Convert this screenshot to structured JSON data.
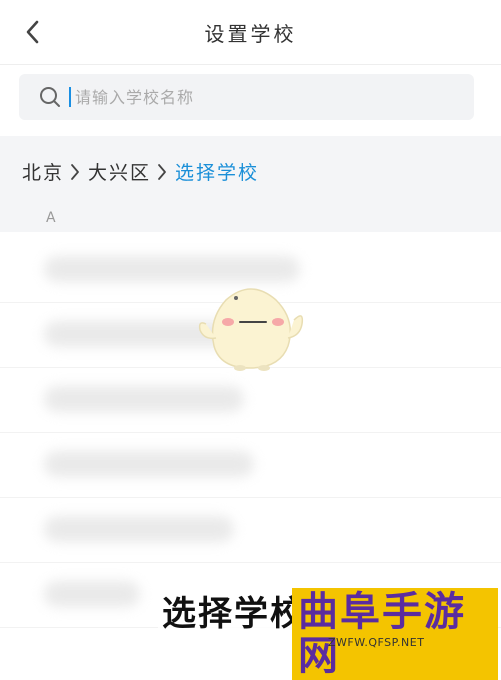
{
  "header": {
    "title": "设置学校"
  },
  "search": {
    "placeholder": "请输入学校名称"
  },
  "breadcrumb": [
    {
      "label": "北京"
    },
    {
      "label": "大兴区"
    },
    {
      "label": "选择学校"
    }
  ],
  "index_letter": "A",
  "caption": "选择学校",
  "watermark": {
    "text": "曲阜手游网",
    "url": "ZWFW.QFSP.NET"
  },
  "colors": {
    "accent": "#1a8fd8",
    "breadcrumb_bg": "#f4f5f7",
    "search_bg": "#f2f3f5"
  }
}
